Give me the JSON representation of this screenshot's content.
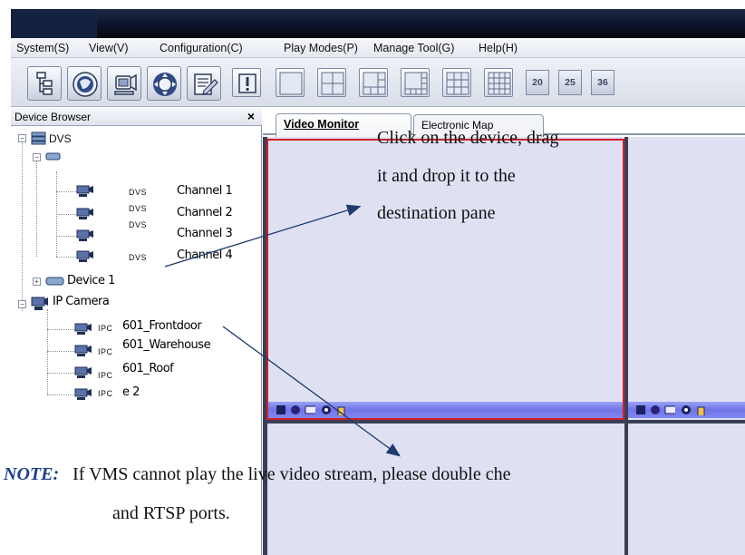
{
  "menu": {
    "items": [
      "System(S)",
      "View(V)",
      "Configuration(C)",
      "Play Modes(P)",
      "Manage Tool(G)",
      "Help(H)"
    ]
  },
  "toolbar": {
    "tool_icons": [
      "device-tree-icon",
      "globe-icon",
      "record-icon",
      "ptz-icon",
      "log-icon"
    ],
    "layout_icons": [
      "alert-icon",
      "layout-1-icon",
      "layout-4-icon",
      "layout-6-icon",
      "layout-8-icon",
      "layout-9-icon",
      "layout-16-icon"
    ],
    "layout_counts": [
      "20",
      "25",
      "36"
    ]
  },
  "browser": {
    "title": "Device Browser",
    "close": "×",
    "dvs_group": "DVS",
    "channel_prefix": "DVS",
    "channels": [
      "Channel 1",
      "Channel 2",
      "Channel 3",
      "Channel 4"
    ],
    "device1": "Device 1",
    "ip_group": "IP Camera",
    "ipc_prefix": "IPC",
    "cameras": [
      "601_Frontdoor",
      "601_Warehouse",
      "601_Roof",
      "e 2"
    ]
  },
  "tabs": [
    "Video Monitor",
    "Electronic Map"
  ],
  "annotation": {
    "line1": "Click on the device, drag",
    "line2": "it and drop it to the",
    "line3": "destination pane"
  },
  "note": {
    "label": "NOTE:",
    "line1": "If VMS cannot play the live video stream, please double che",
    "line2": "and RTSP ports."
  },
  "colors": {
    "selected_pane_border": "#d0202a",
    "pane_toolbar": "#7a80ee",
    "note_label": "#1d3f8f",
    "title_bar": "#0c1226"
  }
}
